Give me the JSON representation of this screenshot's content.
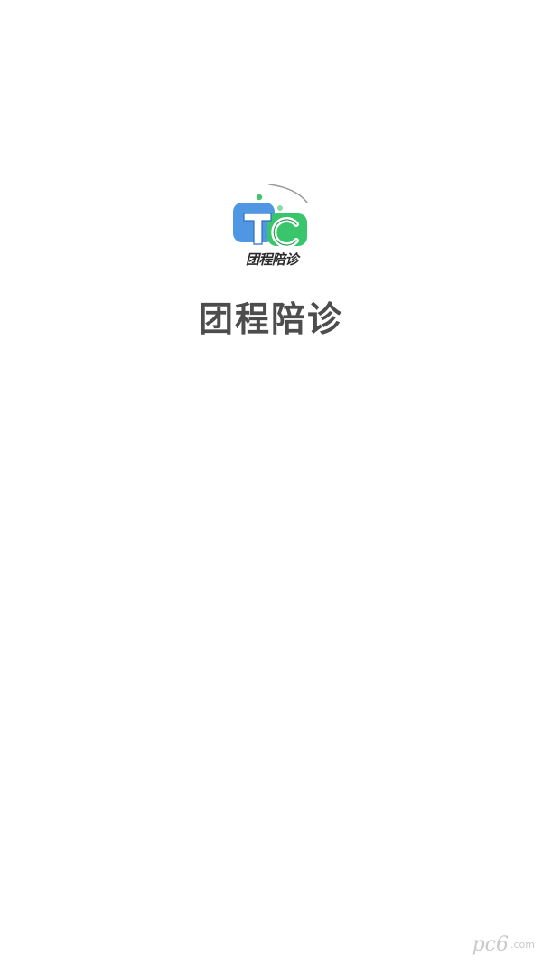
{
  "splash": {
    "logo": {
      "icon": "tc-logo-icon",
      "letters": "Tc",
      "caption": "团程陪诊",
      "colors": {
        "blue": "#4f97e3",
        "green": "#38c56b",
        "dot": "#46c36f",
        "arc": "#9a9a9a"
      }
    },
    "title": "团程陪诊"
  },
  "watermark": {
    "main": "pc6",
    "sub": ".com"
  }
}
